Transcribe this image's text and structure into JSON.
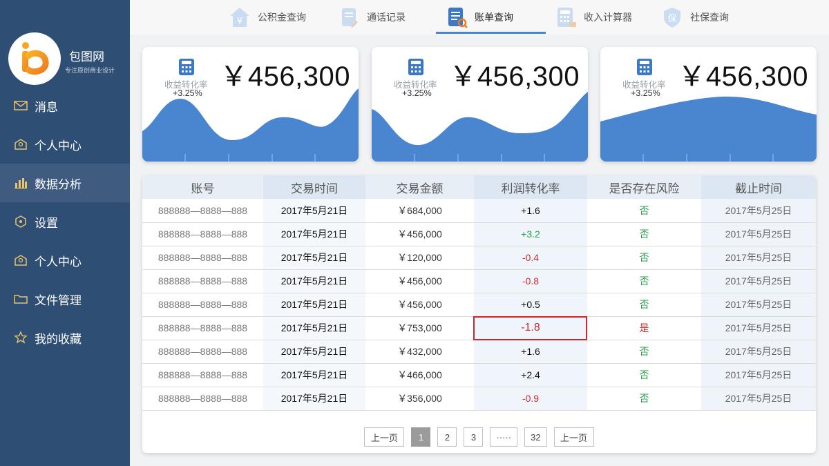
{
  "brand": {
    "name": "包图网",
    "slogan": "专注原创商业设计"
  },
  "colors": {
    "sidebar": "#2f4e74",
    "accent": "#4a86d0",
    "wave": "#4a86d0",
    "positive": "#25a04a",
    "negative": "#cc2b2b"
  },
  "sidebar": {
    "items": [
      {
        "label": "消息",
        "icon": "mail-icon"
      },
      {
        "label": "个人中心",
        "icon": "user-envelope-icon"
      },
      {
        "label": "数据分析",
        "icon": "bar-chart-icon",
        "active": true
      },
      {
        "label": "设置",
        "icon": "settings-icon"
      },
      {
        "label": "个人中心",
        "icon": "user-envelope-icon"
      },
      {
        "label": "文件管理",
        "icon": "folder-icon"
      },
      {
        "label": "我的收藏",
        "icon": "star-icon"
      }
    ]
  },
  "tabs": [
    {
      "label": "公积金查询",
      "icon": "yuan-house-icon"
    },
    {
      "label": "通话记录",
      "icon": "notes-icon"
    },
    {
      "label": "账单查询",
      "icon": "bill-search-icon",
      "active": true
    },
    {
      "label": "收入计算器",
      "icon": "calculator-icon"
    },
    {
      "label": "社保查询",
      "icon": "shield-icon"
    }
  ],
  "cards": [
    {
      "amount": "￥456,300",
      "label": "收益转化率",
      "change": "+3.25%"
    },
    {
      "amount": "￥456,300",
      "label": "收益转化率",
      "change": "+3.25%"
    },
    {
      "amount": "￥456,300",
      "label": "收益转化率",
      "change": "+3.25%"
    }
  ],
  "table": {
    "headers": [
      "账号",
      "交易时间",
      "交易金额",
      "利润转化率",
      "是否存在风险",
      "截止时间"
    ],
    "rows": [
      [
        "888888—8888—888",
        "2017年5月21日",
        "￥684,000",
        "+1.6",
        "否",
        "2017年5月25日"
      ],
      [
        "888888—8888—888",
        "2017年5月21日",
        "￥456,000",
        "+3.2",
        "否",
        "2017年5月25日"
      ],
      [
        "888888—8888—888",
        "2017年5月21日",
        "￥120,000",
        "-0.4",
        "否",
        "2017年5月25日"
      ],
      [
        "888888—8888—888",
        "2017年5月21日",
        "￥456,000",
        "-0.8",
        "否",
        "2017年5月25日"
      ],
      [
        "888888—8888—888",
        "2017年5月21日",
        "￥456,000",
        "+0.5",
        "否",
        "2017年5月25日"
      ],
      [
        "888888—8888—888",
        "2017年5月21日",
        "￥753,000",
        "-1.8",
        "是",
        "2017年5月25日"
      ],
      [
        "888888—8888—888",
        "2017年5月21日",
        "￥432,000",
        "+1.6",
        "否",
        "2017年5月25日"
      ],
      [
        "888888—8888—888",
        "2017年5月21日",
        "￥466,000",
        "+2.4",
        "否",
        "2017年5月25日"
      ],
      [
        "888888—8888—888",
        "2017年5月21日",
        "￥356,000",
        "-0.9",
        "否",
        "2017年5月25日"
      ]
    ],
    "rate_colors": [
      "pos",
      "green",
      "red",
      "red",
      "pos",
      "red",
      "pos",
      "pos",
      "red"
    ],
    "risk_colors": [
      "green",
      "green",
      "green",
      "green",
      "green",
      "red",
      "green",
      "green",
      "green"
    ]
  },
  "pagination": {
    "prev": "上一页",
    "pages": [
      "1",
      "2",
      "3",
      "·····",
      "32"
    ],
    "next": "上一页",
    "current": "1"
  }
}
